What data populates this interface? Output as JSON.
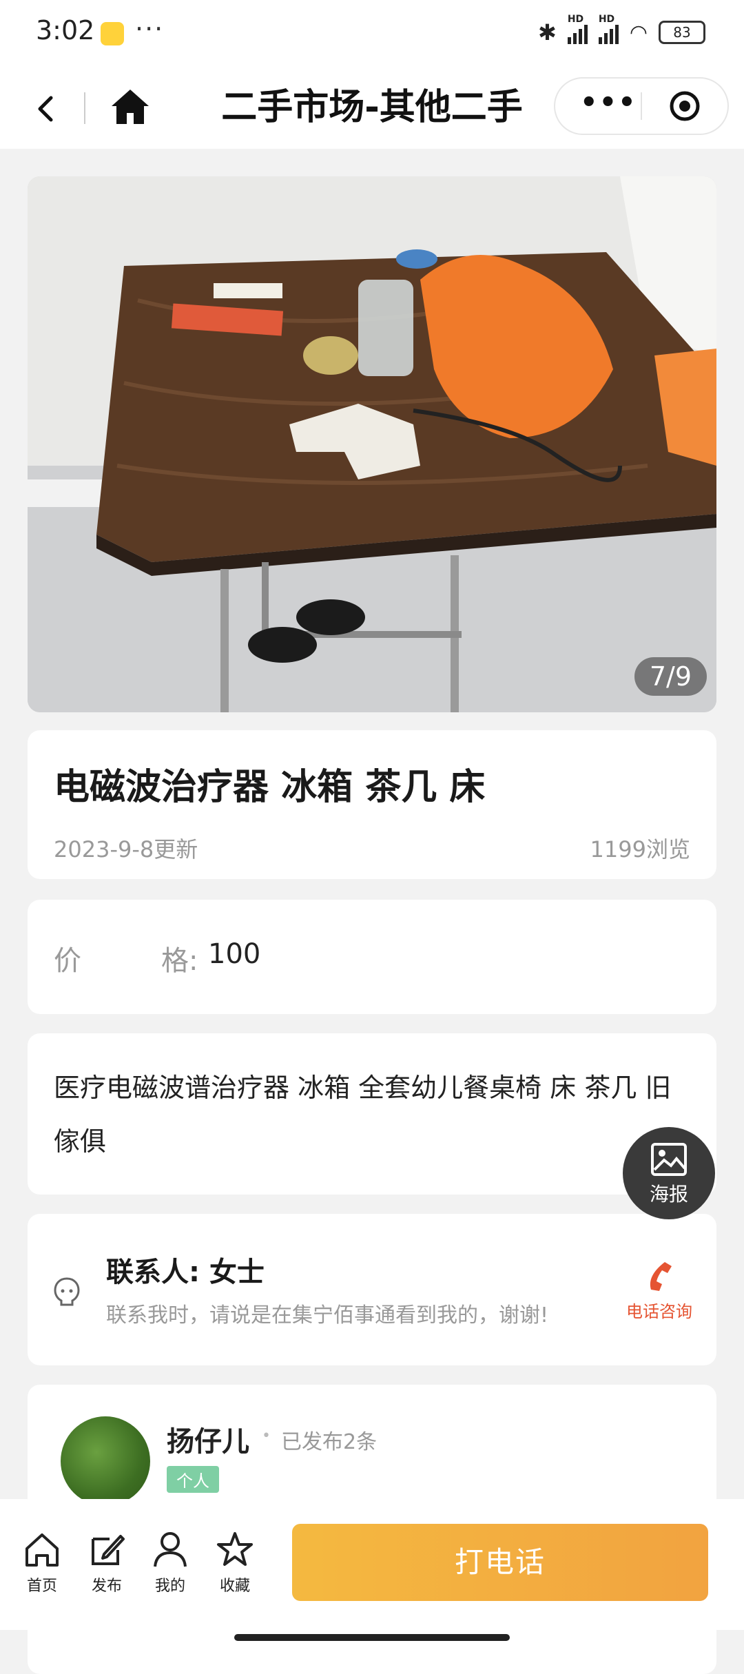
{
  "status_bar": {
    "time": "3:02",
    "dots": "···",
    "battery": "83",
    "signal_label": "HD"
  },
  "nav": {
    "title": "二手市场-其他二手",
    "capsule_dots": "•••"
  },
  "photo": {
    "counter": "7/9"
  },
  "item": {
    "title": "电磁波治疗器 冰箱 茶几 床",
    "updated": "2023-9-8更新",
    "views": "1199浏览"
  },
  "price": {
    "label_char1": "价",
    "label_char2": "格:",
    "value": "100"
  },
  "description": "医疗电磁波谱治疗器 冰箱 全套幼儿餐桌椅 床 茶几 旧傢俱",
  "contact": {
    "name": "联系人: 女士",
    "hint": "联系我时，请说是在集宁佰事通看到我的，谢谢!",
    "call_consult": "电话咨询"
  },
  "poster": {
    "label": "海报"
  },
  "user": {
    "name": "扬仔儿",
    "dot": "•",
    "posts": "已发布2条",
    "badge": "个人"
  },
  "bottom_tabs": [
    {
      "label": "首页",
      "icon": "home-icon"
    },
    {
      "label": "发布",
      "icon": "edit-icon"
    },
    {
      "label": "我的",
      "icon": "user-icon"
    },
    {
      "label": "收藏",
      "icon": "star-icon"
    }
  ],
  "call_button": "打电话",
  "colors": {
    "accent_orange": "#f2a340",
    "call_red": "#e55432",
    "badge_green": "#7fcfa4"
  }
}
